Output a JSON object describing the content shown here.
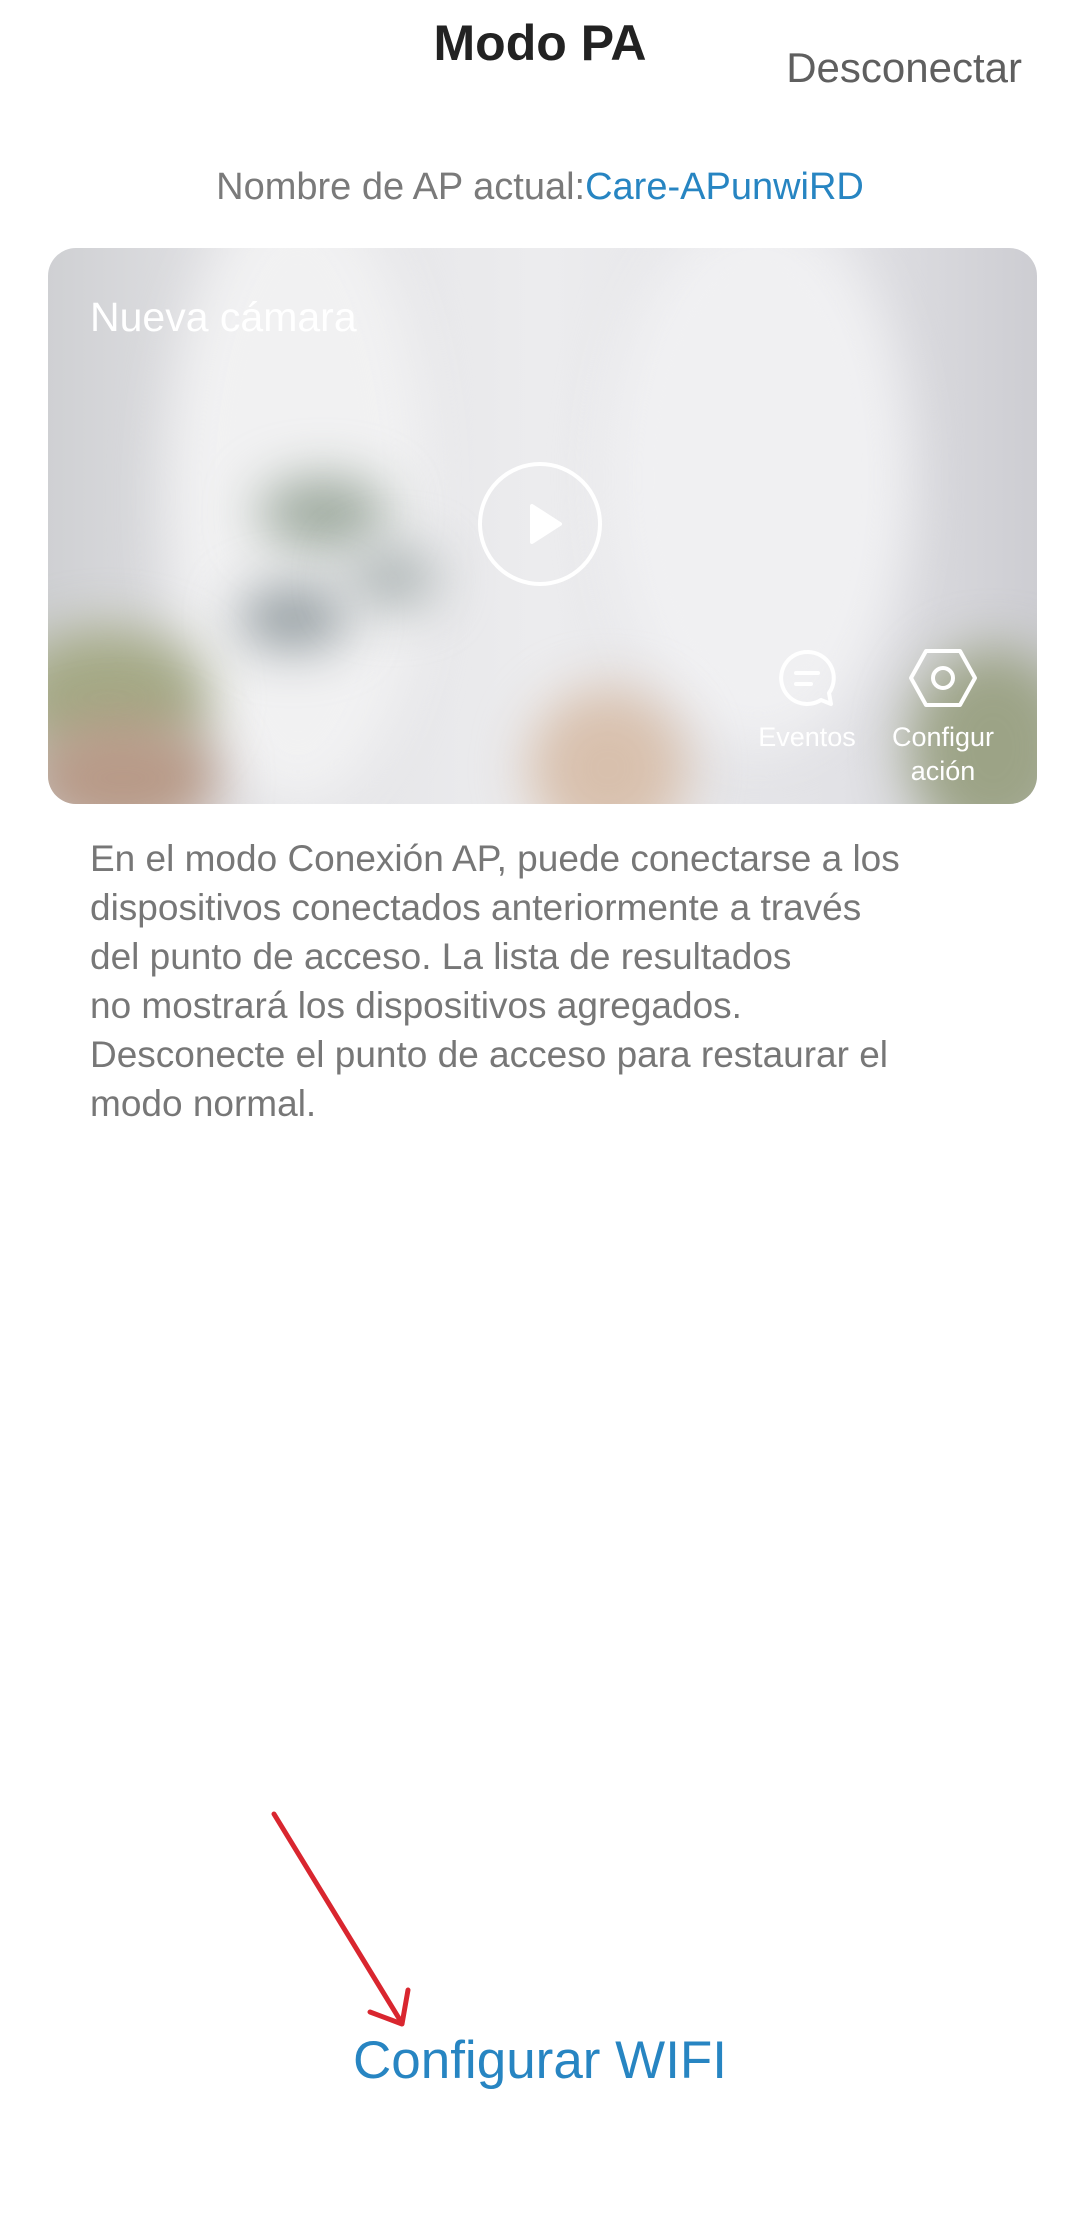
{
  "header": {
    "title": "Modo PA",
    "disconnect_label": "Desconectar"
  },
  "ap_info": {
    "label": "Nombre de AP actual:",
    "name": "Care-APunwiRD"
  },
  "camera_card": {
    "name": "Nueva cámara",
    "play_icon": "play-icon",
    "actions": [
      {
        "label": "Eventos",
        "icon": "chat-bubble-icon"
      },
      {
        "label": "Configur\nación",
        "icon": "hexagon-settings-icon"
      }
    ]
  },
  "description": {
    "lines": [
      "En el modo Conexión AP, puede conectarse a los",
      "dispositivos conectados anteriormente a través",
      "del punto de acceso. La lista de resultados",
      "no mostrará los dispositivos agregados.",
      "Desconecte el punto de acceso para restaurar el",
      "modo normal."
    ]
  },
  "footer": {
    "configure_wifi_label": "Configurar WIFI"
  },
  "colors": {
    "accent": "#2785c2",
    "annotation_arrow": "#d9262f",
    "title_text": "#222222",
    "body_text": "#777777"
  }
}
